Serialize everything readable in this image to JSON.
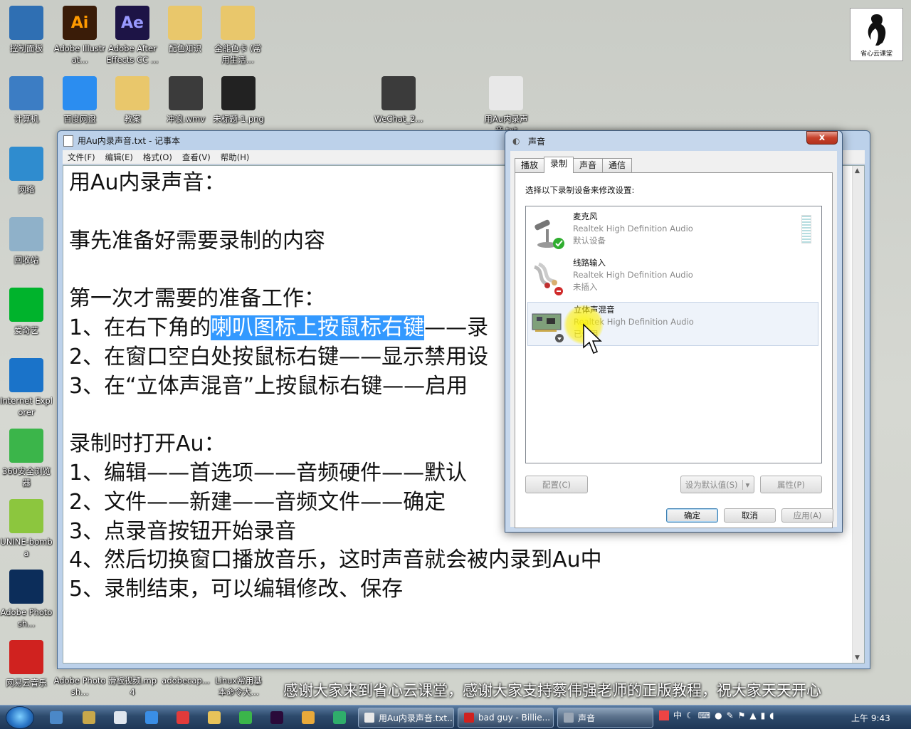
{
  "desktop": {
    "icons_left": [
      {
        "label": "控制面板",
        "color": "#2f6fb3",
        "icon": "control-panel"
      },
      {
        "label": "计算机",
        "color": "#3c7dc4",
        "icon": "computer"
      },
      {
        "label": "网络",
        "color": "#2f8ccf",
        "icon": "network"
      },
      {
        "label": "回收站",
        "color": "#8fb1c9",
        "icon": "recycle-bin"
      },
      {
        "label": "爱奇艺",
        "color": "#00b32c",
        "icon": "iqiyi"
      },
      {
        "label": "Internet Explorer",
        "color": "#1a73c9",
        "icon": "ie"
      },
      {
        "label": "360安全浏览器",
        "color": "#3bb54a",
        "icon": "browser-360"
      },
      {
        "label": "UNINE-bomba",
        "color": "#8cc63e",
        "icon": "iqiyi-folder"
      },
      {
        "label": "Adobe Photosh...",
        "color": "#0c2d5a",
        "icon": "photoshop"
      },
      {
        "label": "网易云音乐",
        "color": "#d0221f",
        "icon": "netease-music"
      }
    ],
    "icons_top": [
      {
        "label": "Adobe Illustrat...",
        "color": "#3a1c08",
        "icon": "illustrator",
        "glyph": "Ai"
      },
      {
        "label": "Adobe After Effects CC ...",
        "color": "#1d1446",
        "icon": "after-effects",
        "glyph": "Ae"
      },
      {
        "label": "配色知识",
        "color": "#e9c76b",
        "icon": "folder"
      },
      {
        "label": "全能色卡 (常用生活...",
        "color": "#e9c76b",
        "icon": "folder"
      }
    ],
    "icons_row2": [
      {
        "label": "百度网盘",
        "color": "#2b8df0",
        "icon": "baidu-netdisk"
      },
      {
        "label": "教案",
        "color": "#e9c76b",
        "icon": "folder"
      },
      {
        "label": "冲浪.wmv",
        "color": "#3b3b3b",
        "icon": "video-file"
      },
      {
        "label": "未标题-1.png",
        "color": "#222222",
        "icon": "image-file"
      },
      {
        "label": "WeChat_2...",
        "color": "#3b3b3b",
        "icon": "video-file"
      },
      {
        "label": "用Au内录声音.txt",
        "color": "#e8e8e8",
        "icon": "text-file"
      }
    ],
    "icons_bottom": [
      {
        "label": "Adobe Photosh...",
        "color": "#0c2d5a",
        "icon": "photoshop"
      },
      {
        "label": "滑板视频.mp4",
        "color": "#3b3b3b",
        "icon": "video-file"
      },
      {
        "label": "adobecap...",
        "color": "#999999",
        "icon": "file"
      },
      {
        "label": "Linux常用基本命令大...",
        "color": "#999999",
        "icon": "file"
      }
    ],
    "logo_text": "省心云课堂"
  },
  "notepad": {
    "title": "用Au内录声音.txt - 记事本",
    "menu": [
      "文件(F)",
      "编辑(E)",
      "格式(O)",
      "查看(V)",
      "帮助(H)"
    ],
    "lines": [
      "用Au内录声音：",
      "",
      "事先准备好需要录制的内容",
      "",
      "第一次才需要的准备工作：",
      "1、在右下角的",
      "2、在窗口空白处按鼠标右键——显示禁用设",
      "3、在“立体声混音”上按鼠标右键——启用",
      "",
      "录制时打开Au：",
      "1、编辑——首选项——音频硬件——默认",
      "2、文件——新建——音频文件——确定",
      "3、点录音按钮开始录音",
      "4、然后切换窗口播放音乐，这时声音就会被内录到Au中",
      "5、录制结束，可以编辑修改、保存"
    ],
    "selected_text": "喇叭图标上按鼠标右键",
    "after_selected": "——录",
    "selection_color": "#3399ff"
  },
  "sound_dialog": {
    "title": "声音",
    "close_glyph": "x",
    "tabs": [
      "播放",
      "录制",
      "声音",
      "通信"
    ],
    "active_tab": "录制",
    "hint": "选择以下录制设备来修改设置:",
    "devices": [
      {
        "name": "麦克风",
        "driver": "Realtek High Definition Audio",
        "status": "默认设备",
        "icon": "microphone-icon",
        "badge": "#2fae2f"
      },
      {
        "name": "线路输入",
        "driver": "Realtek High Definition Audio",
        "status": "未插入",
        "icon": "line-in-icon",
        "badge": "#d02b2b"
      },
      {
        "name": "立体声混音",
        "driver": "Realtek High Definition Audio",
        "status": "已停用",
        "icon": "sound-card-icon",
        "badge": "#555555"
      }
    ],
    "buttons": {
      "configure": "配置(C)",
      "set_default": "设为默认值(S)",
      "properties": "属性(P)",
      "ok": "确定",
      "cancel": "取消",
      "apply": "应用(A)"
    }
  },
  "taskbar": {
    "items": [
      {
        "label": "用Au内录声音.txt...",
        "color": "#e8e8e8"
      },
      {
        "label": "bad guy - Billie...",
        "color": "#d0221f"
      },
      {
        "label": "声音",
        "color": "#9aa6b5"
      }
    ],
    "tray_text": "中",
    "clock": "上午 9:43"
  },
  "caption": "感谢大家来到省心云课堂，感谢大家支持蔡伟强老师的正版教程，祝大家天天开心"
}
